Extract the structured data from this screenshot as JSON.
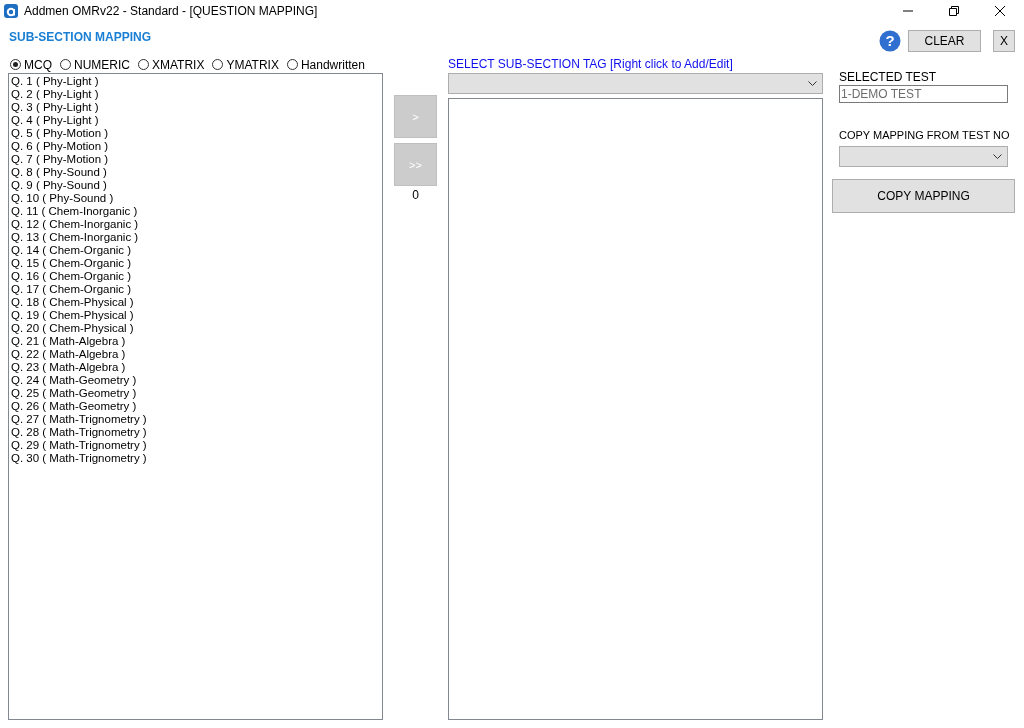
{
  "window": {
    "title": "Addmen OMRv22 - Standard - [QUESTION MAPPING]"
  },
  "heading": "SUB-SECTION MAPPING",
  "toolbar": {
    "help_icon": "?",
    "clear_button": "CLEAR",
    "close_button": "X"
  },
  "question_types": [
    {
      "label": "MCQ",
      "selected": true
    },
    {
      "label": "NUMERIC",
      "selected": false
    },
    {
      "label": "XMATRIX",
      "selected": false
    },
    {
      "label": "YMATRIX",
      "selected": false
    },
    {
      "label": "Handwritten",
      "selected": false
    }
  ],
  "questions": [
    "Q. 1 ( Phy-Light )",
    "Q. 2 ( Phy-Light )",
    "Q. 3 ( Phy-Light )",
    "Q. 4 ( Phy-Light )",
    "Q. 5 ( Phy-Motion )",
    "Q. 6 ( Phy-Motion )",
    "Q. 7 ( Phy-Motion )",
    "Q. 8 ( Phy-Sound )",
    "Q. 9 ( Phy-Sound )",
    "Q. 10 ( Phy-Sound )",
    "Q. 11 ( Chem-Inorganic )",
    "Q. 12 ( Chem-Inorganic )",
    "Q. 13 ( Chem-Inorganic )",
    "Q. 14 ( Chem-Organic )",
    "Q. 15 ( Chem-Organic )",
    "Q. 16 ( Chem-Organic )",
    "Q. 17 ( Chem-Organic )",
    "Q. 18 ( Chem-Physical )",
    "Q. 19 ( Chem-Physical )",
    "Q. 20 ( Chem-Physical )",
    "Q. 21 ( Math-Algebra )",
    "Q. 22 ( Math-Algebra )",
    "Q. 23 ( Math-Algebra )",
    "Q. 24 ( Math-Geometry )",
    "Q. 25 ( Math-Geometry )",
    "Q. 26 ( Math-Geometry )",
    "Q. 27 ( Math-Trignometry )",
    "Q. 28 ( Math-Trignometry )",
    "Q. 29 ( Math-Trignometry )",
    "Q. 30 ( Math-Trignometry )"
  ],
  "move_buttons": [
    ">",
    ">>"
  ],
  "mapped_count": "0",
  "tag_label": "SELECT SUB-SECTION TAG [Right click to Add/Edit]",
  "selected_test": {
    "label": "SELECTED TEST",
    "value": "1-DEMO TEST"
  },
  "copy_from": {
    "label": "COPY MAPPING FROM TEST NO"
  },
  "copy_button": "COPY MAPPING"
}
